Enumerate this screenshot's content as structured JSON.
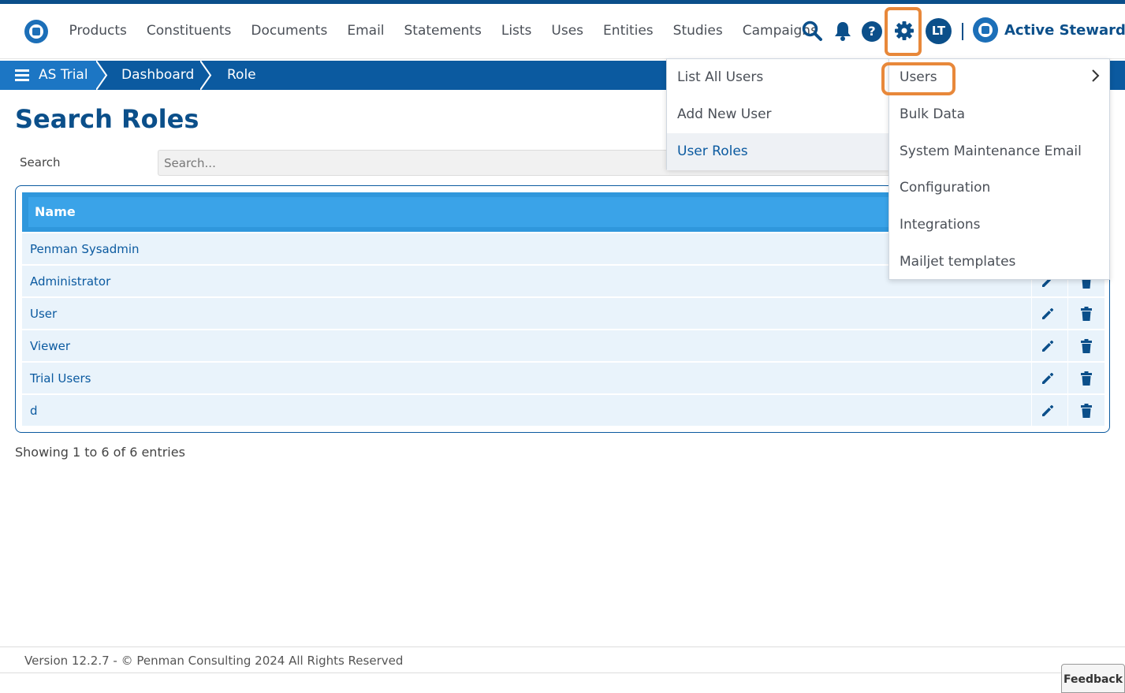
{
  "header": {
    "nav": [
      "Products",
      "Constituents",
      "Documents",
      "Email",
      "Statements",
      "Lists",
      "Uses",
      "Entities",
      "Studies",
      "Campaigns"
    ],
    "avatar_initials": "LT",
    "help_glyph": "?",
    "brand_name": "Active Steward",
    "icons": [
      "search-icon",
      "bell-icon",
      "help-icon",
      "gear-icon"
    ]
  },
  "breadcrumb": {
    "home": "AS Trial",
    "items": [
      "Dashboard",
      "Role"
    ]
  },
  "page": {
    "title": "Search Roles",
    "search_label": "Search",
    "search_placeholder": "Search...",
    "search_value": ""
  },
  "table": {
    "column_header": "Name",
    "rows": [
      "Penman Sysadmin",
      "Administrator",
      "User",
      "Viewer",
      "Trial Users",
      "d"
    ],
    "summary": "Showing 1 to 6 of 6 entries"
  },
  "users_menu": {
    "items": [
      "List All Users",
      "Add New User",
      "User Roles"
    ],
    "active": "User Roles"
  },
  "settings_menu": {
    "items": [
      "Users",
      "Bulk Data",
      "System Maintenance Email",
      "Configuration",
      "Integrations",
      "Mailjet templates"
    ],
    "highlighted": "Users"
  },
  "footer": {
    "text": "Version 12.2.7 - © Penman Consulting 2024 All Rights Reserved",
    "feedback_label": "Feedback"
  },
  "colors": {
    "brand_dark": "#0b4f8a",
    "breadcrumb_bar": "#0b5aa0",
    "table_header": "#2f97dc",
    "row_bg": "#e9f3fb",
    "highlight_orange": "#e8883a"
  }
}
